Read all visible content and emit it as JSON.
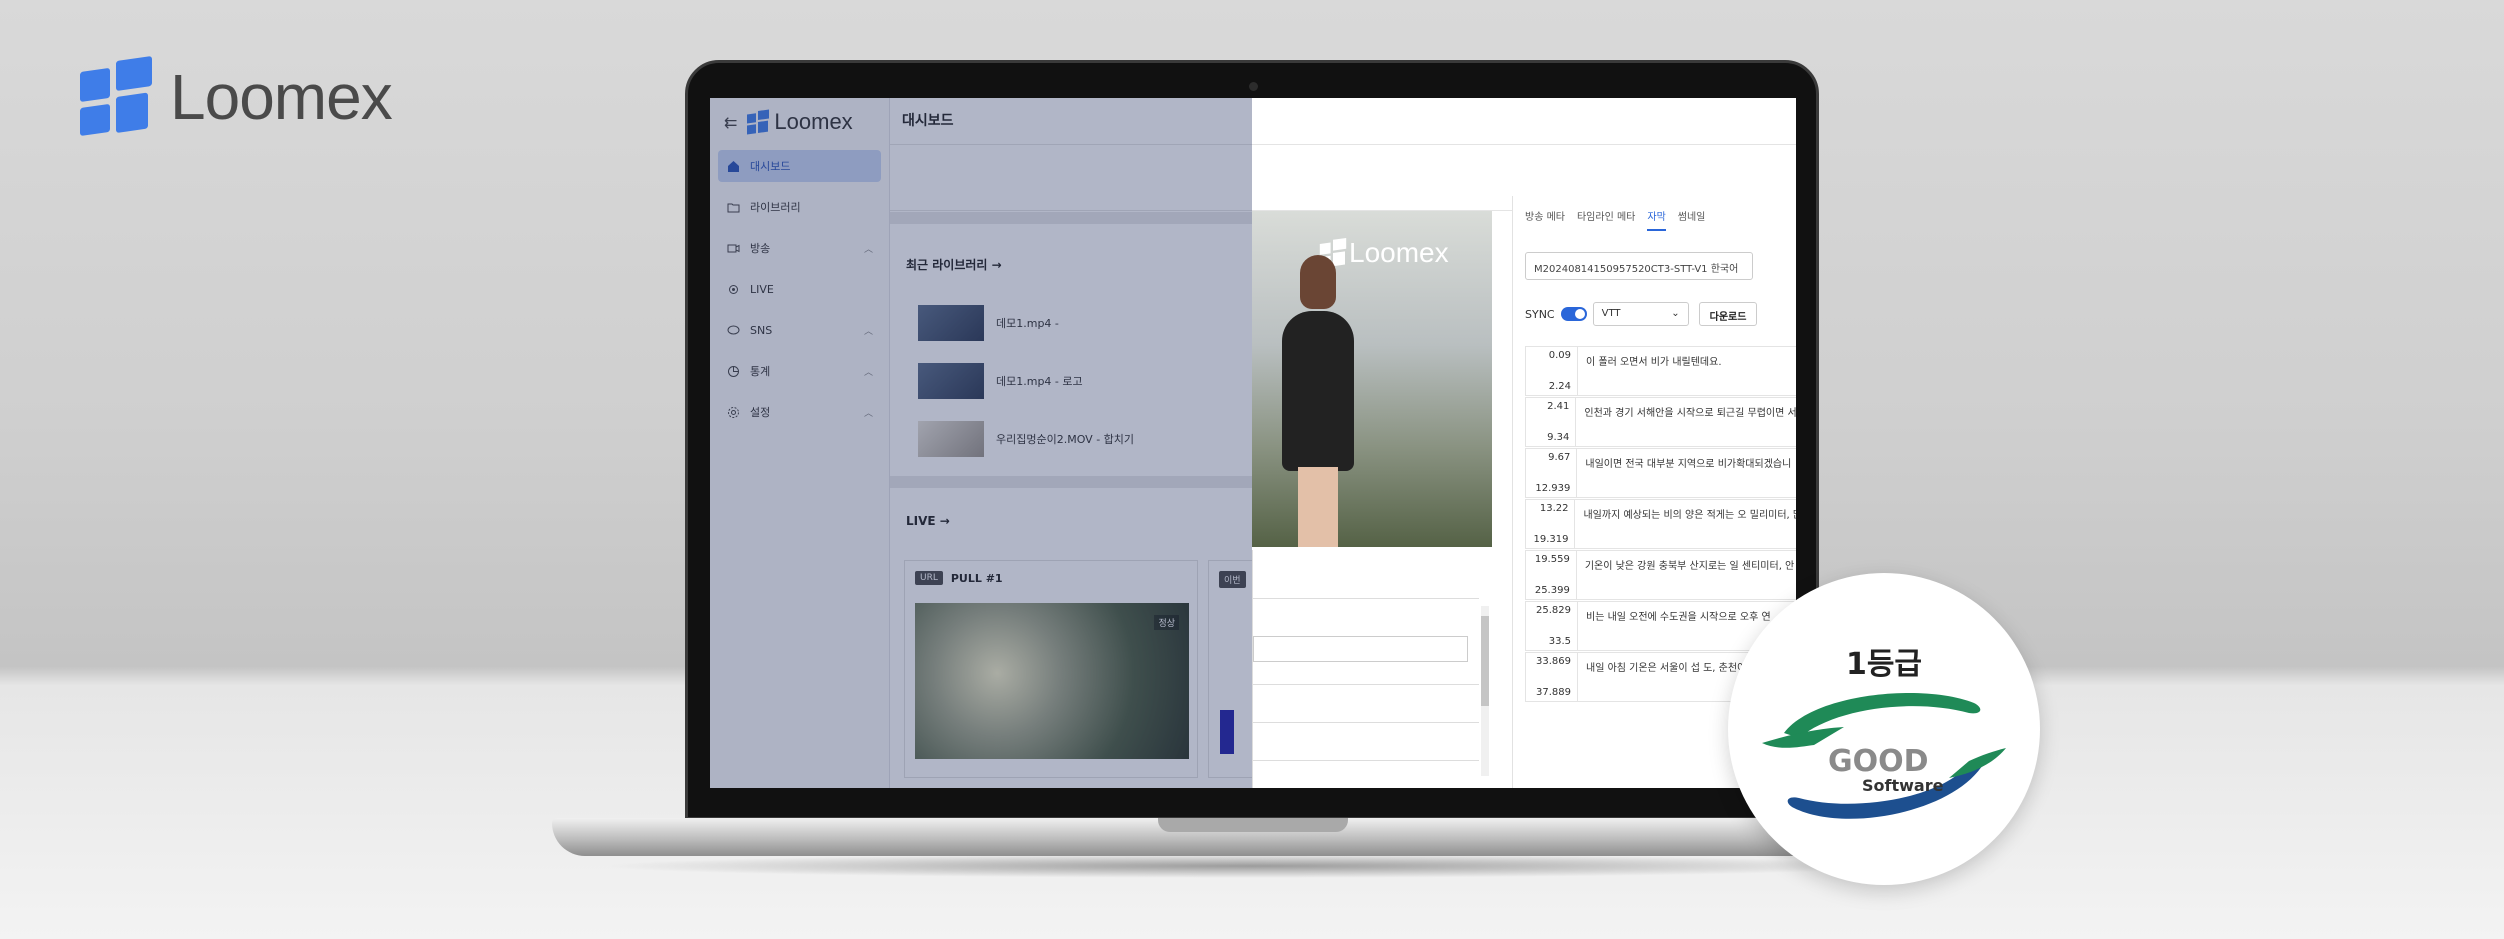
{
  "brand": {
    "name": "Loomex"
  },
  "sidebar": {
    "logo_text": "Loomex",
    "items": [
      {
        "label": "대시보드",
        "icon": "home-icon",
        "active": true
      },
      {
        "label": "라이브러리",
        "icon": "folder-icon"
      },
      {
        "label": "방송",
        "icon": "video-icon",
        "expandable": true
      },
      {
        "label": "LIVE",
        "icon": "broadcast-icon"
      },
      {
        "label": "SNS",
        "icon": "chat-icon",
        "expandable": true
      },
      {
        "label": "통계",
        "icon": "chart-icon",
        "expandable": true
      },
      {
        "label": "설정",
        "icon": "gear-icon",
        "expandable": true
      }
    ]
  },
  "main": {
    "title": "대시보드",
    "recent": {
      "title": "최근 라이브러리",
      "arrow": "→",
      "items": [
        {
          "label": "데모1.mp4 -"
        },
        {
          "label": "데모1.mp4 - 로고"
        },
        {
          "label": "우리집멍순이2.MOV - 합치기"
        }
      ]
    },
    "live": {
      "title": "LIVE",
      "arrow": "→",
      "card": {
        "badge": "URL",
        "name": "PULL #1",
        "status": "정상"
      },
      "card2_badge": "이번"
    }
  },
  "player": {
    "logo_text": "Loomex"
  },
  "panel": {
    "tabs": [
      "방송 메타",
      "타임라인 메타",
      "자막",
      "썸네일"
    ],
    "active_tab": 2,
    "file_select": "M20240814150957520CT3-STT-V1 한국어",
    "sync_label": "SYNC",
    "format_select": "VTT",
    "download_label": "다운로드",
    "subtitles": [
      {
        "start": "0.09",
        "end": "2.24",
        "text": "이 폴러 오면서 비가 내릴텐데요."
      },
      {
        "start": "2.41",
        "end": "9.34",
        "text": "인천과 경기 서해안을 시작으로 퇴근길 무렵이면 서"
      },
      {
        "start": "9.67",
        "end": "12.939",
        "text": "내일이면 전국 대부분 지역으로 비가확대되겠습니"
      },
      {
        "start": "13.22",
        "end": "19.319",
        "text": "내일까지 예상되는 비의 양은 적게는 오 밀리미터, 많"
      },
      {
        "start": "19.559",
        "end": "25.399",
        "text": "기온이 낮은 강원 충북부 산지로는 일 센티미터, 안"
      },
      {
        "start": "25.829",
        "end": "33.5",
        "text": "비는 내일 오전에 수도권을 시작으로 오후 연"
      },
      {
        "start": "33.869",
        "end": "37.889",
        "text": "내일 아침 기온은 서울이 섭 도, 춘천이"
      }
    ]
  },
  "badge": {
    "grade": "1등급",
    "logo_word": "GOOD",
    "logo_sub": "Software"
  },
  "colors": {
    "accent": "#2a66d9",
    "brand_blue": "#3f7de8",
    "gs_green": "#1f8a57",
    "gs_blue": "#1d4f8f"
  }
}
